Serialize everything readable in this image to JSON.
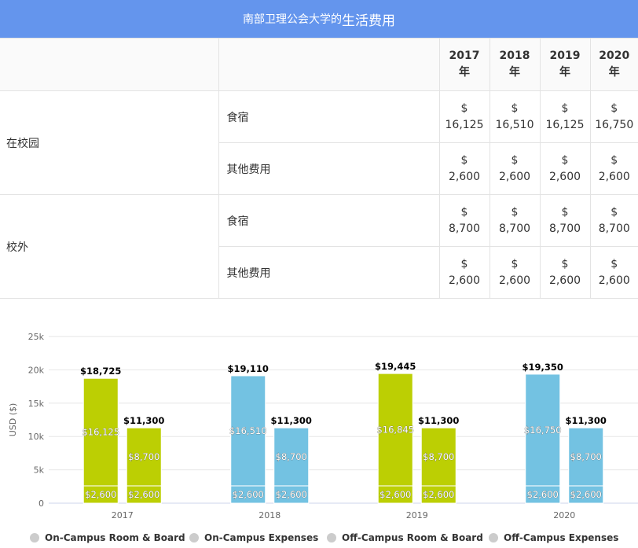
{
  "header": {
    "title_prefix": "南部卫理公会大学的",
    "title_main": "生活费用"
  },
  "table": {
    "years": [
      {
        "year": "2017",
        "unit": "年"
      },
      {
        "year": "2018",
        "unit": "年"
      },
      {
        "year": "2019",
        "unit": "年"
      },
      {
        "year": "2020",
        "unit": "年"
      }
    ],
    "sections": [
      {
        "label": "在校园",
        "rows": [
          {
            "label": "食宿",
            "values": [
              "16,125",
              "16,510",
              "16,125",
              "16,750"
            ]
          },
          {
            "label": "其他费用",
            "values": [
              "2,600",
              "2,600",
              "2,600",
              "2,600"
            ]
          }
        ]
      },
      {
        "label": "校外",
        "rows": [
          {
            "label": "食宿",
            "values": [
              "8,700",
              "8,700",
              "8,700",
              "8,700"
            ]
          },
          {
            "label": "其他费用",
            "values": [
              "2,600",
              "2,600",
              "2,600",
              "2,600"
            ]
          }
        ]
      }
    ],
    "currency": "$"
  },
  "chart_data": {
    "type": "bar",
    "stacked": true,
    "categories": [
      "2017",
      "2018",
      "2019",
      "2020"
    ],
    "ylabel": "USD ($)",
    "ylim": [
      0,
      25000
    ],
    "yticks": [
      0,
      5000,
      10000,
      15000,
      20000,
      25000
    ],
    "ytick_labels": [
      "0",
      "5k",
      "10k",
      "15k",
      "20k",
      "25k"
    ],
    "grid": true,
    "legend_position": "bottom",
    "series": [
      {
        "name": "On-Campus Room & Board",
        "stack": "on",
        "values": [
          16125,
          16510,
          16845,
          16750
        ],
        "labels": [
          "$16,125",
          "$16,510",
          "$16,845",
          "$16,750"
        ]
      },
      {
        "name": "On-Campus Expenses",
        "stack": "on",
        "values": [
          2600,
          2600,
          2600,
          2600
        ],
        "labels": [
          "$2,600",
          "$2,600",
          "$2,600",
          "$2,600"
        ]
      },
      {
        "name": "Off-Campus Room & Board",
        "stack": "off",
        "values": [
          8700,
          8700,
          8700,
          8700
        ],
        "labels": [
          "$8,700",
          "$8,700",
          "$8,700",
          "$8,700"
        ]
      },
      {
        "name": "Off-Campus Expenses",
        "stack": "off",
        "values": [
          2600,
          2600,
          2600,
          2600
        ],
        "labels": [
          "$2,600",
          "$2,600",
          "$2,600",
          "$2,600"
        ]
      }
    ],
    "totals": {
      "on": [
        "$18,725",
        "$19,110",
        "$19,445",
        "$19,350"
      ],
      "off": [
        "$11,300",
        "$11,300",
        "$11,300",
        "$11,300"
      ]
    },
    "bar_colors": [
      "#bccf03",
      "#73c2e2",
      "#bccf03",
      "#73c2e2"
    ],
    "legend_marker_color": "#cccccc"
  }
}
